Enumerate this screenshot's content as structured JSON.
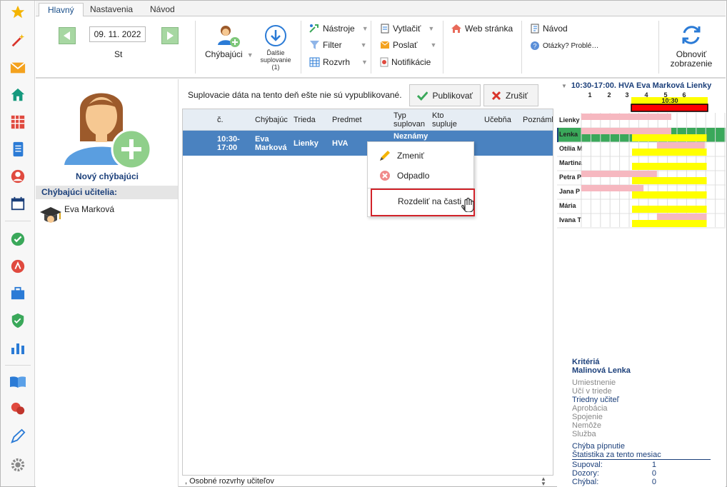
{
  "ribbon": {
    "tabs": [
      "Hlavný",
      "Nastavenia",
      "Návod"
    ],
    "date": "09. 11. 2022",
    "weekday": "St",
    "absent_label": "Chýbajúci",
    "next_sub_label": "Ďalšie suplovanie",
    "next_sub_count": "(1)",
    "tools": "Nástroje",
    "filter": "Filter",
    "schedule": "Rozvrh",
    "print": "Vytlačiť",
    "send": "Poslať",
    "notifications": "Notifikácie",
    "website": "Web stránka",
    "guide": "Návod",
    "questions": "Otázky? Problé…",
    "refresh_line1": "Obnoviť",
    "refresh_line2": "zobrazenie"
  },
  "left_panel": {
    "new_absent": "Nový chýbajúci",
    "section_title": "Chýbajúci učitelia:",
    "teachers": [
      "Eva Marková"
    ]
  },
  "center": {
    "notice": "Suplovacie dáta na tento deň ešte nie sú vypublikované.",
    "publish": "Publikovať",
    "cancel": "Zrušiť",
    "columns": [
      "č.",
      "Chýbajúc",
      "Trieda",
      "Predmet",
      "Typ suplovan",
      "Kto supluje",
      "Učebňa",
      "Poznámk"
    ],
    "row": {
      "time": "10:30-17:00",
      "absent": "Eva Marková",
      "class": "Lienky",
      "subject": "HVA",
      "type": "Neznámy"
    },
    "status": ", Osobné rozvrhy učiteľov"
  },
  "context_menu": {
    "items": [
      "Zmeniť",
      "Odpadlo",
      "Rozdeliť na časti"
    ]
  },
  "timeline": {
    "title": "10:30-17:00. HVA Eva Marková Lienky",
    "periods": [
      "1",
      "2",
      "3",
      "4",
      "5",
      "6"
    ],
    "time_label": "10:30",
    "rows": [
      "Lienky",
      "Lenka",
      "Otília M",
      "Martina",
      "Petra P",
      "Jana P",
      "Mária",
      "Ivana T"
    ]
  },
  "criteria": {
    "title": "Kritériá",
    "name": "Malinová Lenka",
    "items": [
      "Umiestnenie",
      "Učí v triede",
      "Triedny učiteľ",
      "Aprobácia",
      "Spojenie",
      "Nemôže",
      "Služba"
    ],
    "pin_error": "Chýba pípnutie",
    "stats_title": "Štatistika za tento mesiac",
    "stats": [
      {
        "label": "Supoval:",
        "value": "1"
      },
      {
        "label": "Dozory:",
        "value": "0"
      },
      {
        "label": "Chýbal:",
        "value": "0"
      }
    ]
  },
  "colors": {
    "accent": "#1b3f7a",
    "selected_row": "#4a82c0",
    "green": "#3aa85a",
    "yellow": "#ffff00",
    "pink": "#f6b8c0",
    "red": "#ff0000"
  }
}
